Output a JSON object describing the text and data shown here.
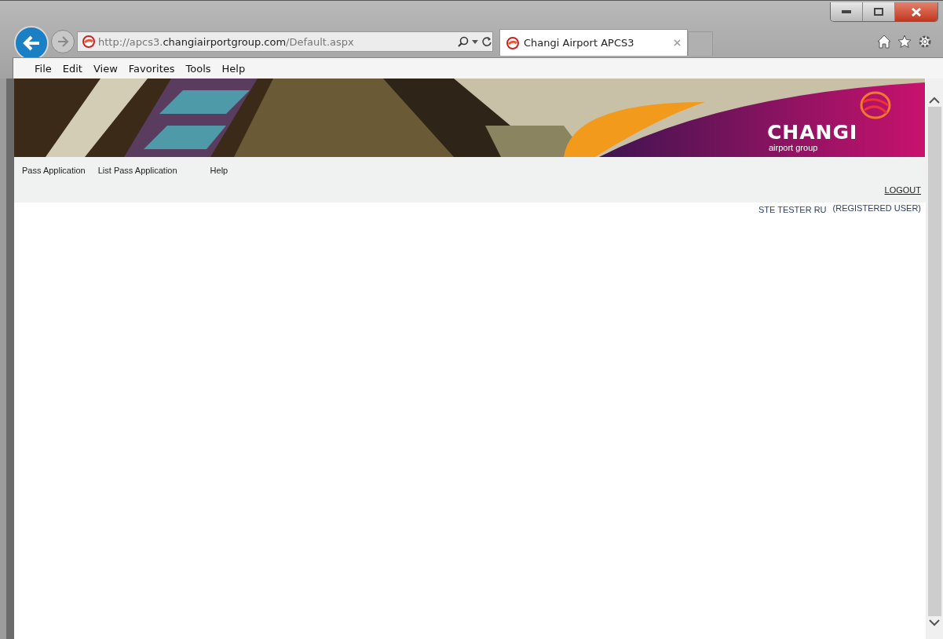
{
  "browser": {
    "address": {
      "url": "http://apcs3.**changiairportgroup.com**/Default.aspx"
    },
    "tabs": [
      {
        "title": "Changi Airport APCS3",
        "selected": true
      }
    ],
    "menu": [
      "File",
      "Edit",
      "View",
      "Favorites",
      "Tools",
      "Help"
    ]
  },
  "page": {
    "logo": {
      "name": "CHANGI",
      "tagline": "airport group"
    },
    "nav": [
      "Pass Application",
      "List Pass Application",
      "Help"
    ],
    "logout": "LOGOUT",
    "user_name": "STE TESTER RU",
    "user_role": "(REGISTERED USER)"
  }
}
